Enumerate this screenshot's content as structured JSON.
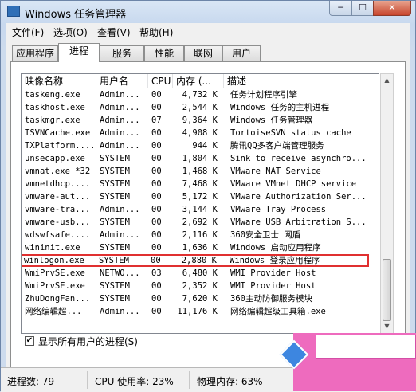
{
  "window": {
    "title": "Windows 任务管理器",
    "minimize_label": "─",
    "maximize_label": "☐",
    "close_label": "✕"
  },
  "menu": [
    "文件(F)",
    "选项(O)",
    "查看(V)",
    "帮助(H)"
  ],
  "tabs": [
    {
      "label": "应用程序"
    },
    {
      "label": "进程",
      "active": true
    },
    {
      "label": "服务"
    },
    {
      "label": "性能"
    },
    {
      "label": "联网"
    },
    {
      "label": "用户"
    }
  ],
  "columns": [
    "映像名称",
    "用户名",
    "CPU",
    "内存 (...",
    "描述"
  ],
  "processes": [
    {
      "name": "taskeng.exe",
      "user": "Admin...",
      "cpu": "00",
      "mem": "4,732 K",
      "desc": "任务计划程序引擎"
    },
    {
      "name": "taskhost.exe",
      "user": "Admin...",
      "cpu": "00",
      "mem": "2,544 K",
      "desc": "Windows 任务的主机进程"
    },
    {
      "name": "taskmgr.exe",
      "user": "Admin...",
      "cpu": "07",
      "mem": "9,364 K",
      "desc": "Windows 任务管理器"
    },
    {
      "name": "TSVNCache.exe",
      "user": "Admin...",
      "cpu": "00",
      "mem": "4,908 K",
      "desc": "TortoiseSVN status cache"
    },
    {
      "name": "TXPlatform....",
      "user": "Admin...",
      "cpu": "00",
      "mem": "944 K",
      "desc": "腾讯QQ多客户端管理服务"
    },
    {
      "name": "unsecapp.exe",
      "user": "SYSTEM",
      "cpu": "00",
      "mem": "1,804 K",
      "desc": "Sink to receive asynchro..."
    },
    {
      "name": "vmnat.exe *32",
      "user": "SYSTEM",
      "cpu": "00",
      "mem": "1,468 K",
      "desc": "VMware NAT Service"
    },
    {
      "name": "vmnetdhcp....",
      "user": "SYSTEM",
      "cpu": "00",
      "mem": "7,468 K",
      "desc": "VMware VMnet DHCP service"
    },
    {
      "name": "vmware-aut...",
      "user": "SYSTEM",
      "cpu": "00",
      "mem": "5,172 K",
      "desc": "VMware Authorization Ser..."
    },
    {
      "name": "vmware-tra...",
      "user": "Admin...",
      "cpu": "00",
      "mem": "3,144 K",
      "desc": "VMware Tray Process"
    },
    {
      "name": "vmware-usb...",
      "user": "SYSTEM",
      "cpu": "00",
      "mem": "2,692 K",
      "desc": "VMware USB Arbitration S..."
    },
    {
      "name": "wdswfsafe....",
      "user": "Admin...",
      "cpu": "00",
      "mem": "2,116 K",
      "desc": "360安全卫士 网盾"
    },
    {
      "name": "wininit.exe",
      "user": "SYSTEM",
      "cpu": "00",
      "mem": "1,636 K",
      "desc": "Windows 启动应用程序"
    },
    {
      "name": "winlogon.exe",
      "user": "SYSTEM",
      "cpu": "00",
      "mem": "2,880 K",
      "desc": "Windows 登录应用程序",
      "highlighted": true
    },
    {
      "name": "WmiPrvSE.exe",
      "user": "NETWO...",
      "cpu": "03",
      "mem": "6,480 K",
      "desc": "WMI Provider Host"
    },
    {
      "name": "WmiPrvSE.exe",
      "user": "SYSTEM",
      "cpu": "00",
      "mem": "2,352 K",
      "desc": "WMI Provider Host"
    },
    {
      "name": "ZhuDongFan...",
      "user": "SYSTEM",
      "cpu": "00",
      "mem": "7,620 K",
      "desc": "360主动防御服务模块"
    },
    {
      "name": "网络编辑超...",
      "user": "Admin...",
      "cpu": "00",
      "mem": "11,176 K",
      "desc": "网络编辑超级工具箱.exe"
    }
  ],
  "show_all_users": {
    "checked": true,
    "label": "显示所有用户的进程(S)",
    "check_glyph": "✔"
  },
  "scrollbar": {
    "up_glyph": "▲",
    "down_glyph": "▼"
  },
  "status": {
    "processes": "进程数: 79",
    "cpu": "CPU 使用率: 23%",
    "memory": "物理内存: 63%"
  },
  "colors": {
    "highlight_border": "#e03030",
    "watermark": "#ee6bbe"
  }
}
